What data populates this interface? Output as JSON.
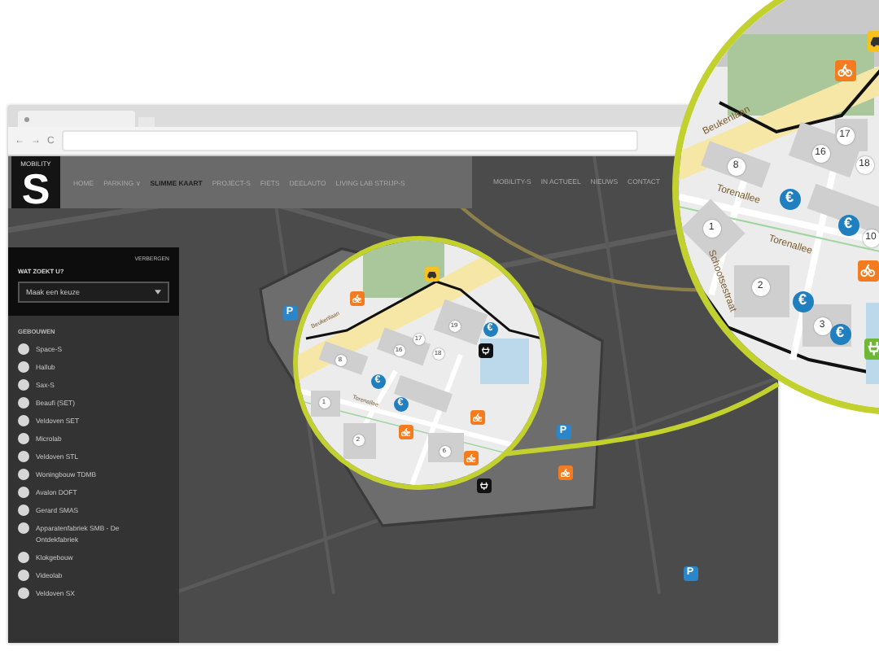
{
  "browser": {
    "nav_buttons": [
      "←",
      "→",
      "C"
    ]
  },
  "site": {
    "logo": {
      "caption": "MOBILITY",
      "letter": "S"
    },
    "nav": [
      {
        "label": "HOME",
        "selected": false
      },
      {
        "label": "PARKING ∨",
        "selected": false
      },
      {
        "label": "SLIMME KAART",
        "selected": true
      },
      {
        "label": "PROJECT-S",
        "selected": false
      },
      {
        "label": "FIETS",
        "selected": false
      },
      {
        "label": "DEELAUTO",
        "selected": false
      },
      {
        "label": "LIVING LAB STRIJP-S",
        "selected": false
      }
    ],
    "nav_right": [
      "MOBILITY-S",
      "IN ACTUEEL",
      "NIEUWS",
      "CONTACT"
    ]
  },
  "sidebar": {
    "hide": "VERBERGEN",
    "question": "WAT ZOEKT U?",
    "select": {
      "value": "Maak een keuze"
    },
    "section": "GEBOUWEN",
    "items": [
      "Space-S",
      "Hallub",
      "Sax-S",
      "Beaufi (SET)",
      "Veldoven SET",
      "Microlab",
      "Veldoven STL",
      "Woningbouw TDMB",
      "Avalon DOFT",
      "Gerard SMAS",
      "Apparatenfabriek SMB - De Ontdekfabriek",
      "Klokgebouw",
      "Videolab",
      "Veldoven SX"
    ]
  },
  "map": {
    "pins": [
      {
        "kind": "parking",
        "label": "P"
      },
      {
        "kind": "parking",
        "label": "P"
      },
      {
        "kind": "parking",
        "label": "P"
      },
      {
        "kind": "bike"
      },
      {
        "kind": "charge"
      }
    ]
  },
  "magnifier_small": {
    "streets": [
      "Beukenlaan",
      "Torenallee"
    ],
    "buildings": [
      "8",
      "16",
      "17",
      "19",
      "18",
      "1",
      "2",
      "6"
    ],
    "pins": [
      {
        "kind": "bike"
      },
      {
        "kind": "car"
      },
      {
        "kind": "charge"
      },
      {
        "kind": "euro",
        "label": "€"
      },
      {
        "kind": "euro",
        "label": "€"
      },
      {
        "kind": "euro",
        "label": "€"
      },
      {
        "kind": "bike"
      },
      {
        "kind": "bike"
      },
      {
        "kind": "bike"
      }
    ]
  },
  "magnifier_large": {
    "streets": [
      "Beukenlaan",
      "Torenallee",
      "Torenallee",
      "Schootsestraat"
    ],
    "buildings": [
      "8",
      "16",
      "17",
      "18",
      "1",
      "2",
      "3",
      "10"
    ],
    "pins": [
      {
        "kind": "bike"
      },
      {
        "kind": "car"
      },
      {
        "kind": "euro",
        "label": "€"
      },
      {
        "kind": "euro",
        "label": "€"
      },
      {
        "kind": "bike"
      },
      {
        "kind": "euro",
        "label": "€"
      },
      {
        "kind": "euro",
        "label": "€"
      },
      {
        "kind": "plug"
      }
    ]
  }
}
